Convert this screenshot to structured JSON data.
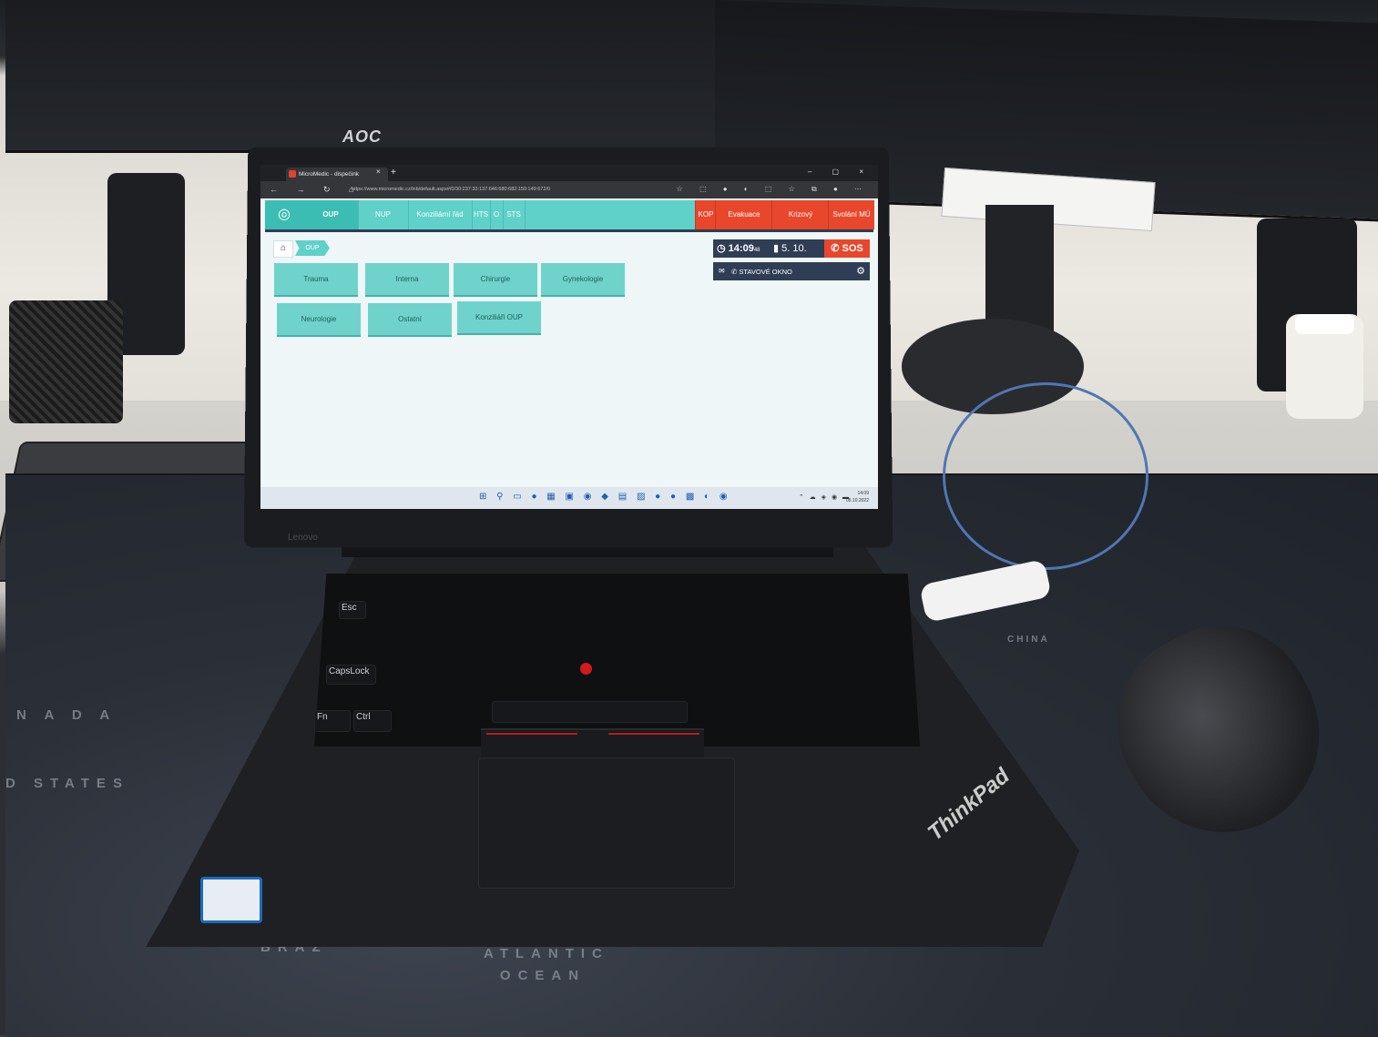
{
  "browser": {
    "tab_title": "MicroMedic - dispečink",
    "tab_close": "×",
    "new_tab": "+",
    "window_controls": "– ▢ ×",
    "nav_buttons": "← → ↻ ⌂",
    "url": "https://www.micromedic.cz/lnb/default.aspx#/0/30:237:33:137:646:680:682:150:149:672/0",
    "extensions": "☆ ⬚ ● ◐ ⬚ ☆ ⧉ ● ⋯"
  },
  "app_nav": {
    "logo_icon": "◎",
    "items": [
      "OUP",
      "NUP",
      "Konziliární řád",
      "HTS",
      "O",
      "STS"
    ],
    "red_items": [
      "KOP",
      "Evakuace",
      "Krizový",
      "Svolání MÚ"
    ]
  },
  "breadcrumb": {
    "home_icon": "⌂",
    "current": "OUP"
  },
  "tiles_row1": [
    "Trauma",
    "Interna",
    "Chirurgie",
    "Gynekologie"
  ],
  "tiles_row2": [
    "Neurologie",
    "Ostatní",
    "Konziliáři OUP"
  ],
  "status_panel": {
    "clock_icon": "◷",
    "time": "14:09",
    "seconds": "48",
    "date_icon": "▮",
    "date": "5. 10.",
    "sos_icon": "✆",
    "sos_label": "SOS",
    "mail_icon": "✉",
    "phone_icon": "✆",
    "window_label": "STAVOVÉ OKNO",
    "gear_icon": "⚙"
  },
  "taskbar": {
    "icons": "⊞ ⚲ ▭ ● ▦ ▣ ◉ ◆ ▤ ▨ ● ● ▩ ◐ ◉",
    "tray": "⌃ ☁ ◈ ◉ ▬",
    "time": "14:09",
    "date": "05.10.2022"
  },
  "scene": {
    "monitor_brand": "AOC",
    "laptop_brand": "Lenovo",
    "laptop_logo": "ThinkPad",
    "mat_text_1": "SOUTH ATLANTIC OCEAN",
    "mat_text_2": "D STATES",
    "mat_text_3": "N A D A",
    "mat_text_4": "CHINA",
    "mat_text_5": "BRAZ"
  },
  "colors": {
    "teal": "#5fd1c9",
    "teal_dark": "#3cbdb4",
    "red": "#e8472c",
    "navy": "#2f3d55"
  }
}
